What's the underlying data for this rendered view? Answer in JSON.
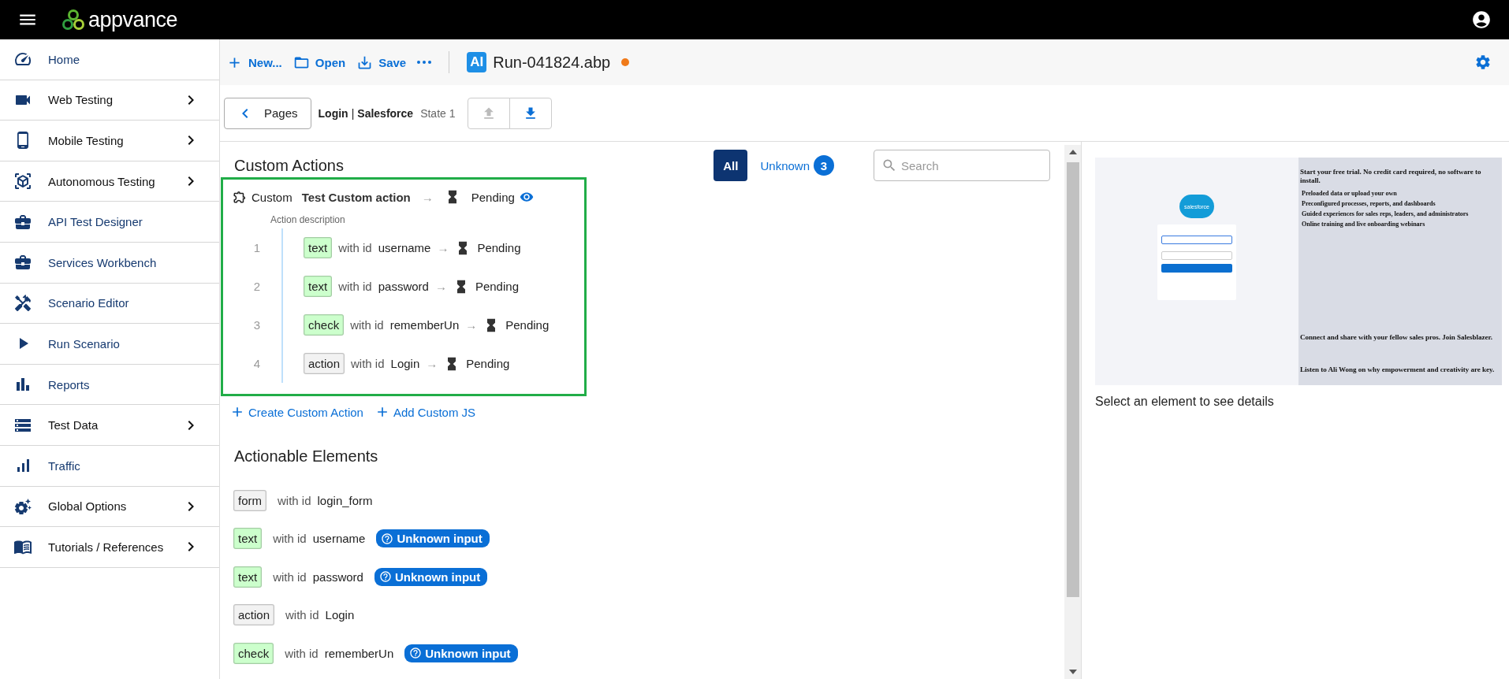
{
  "header": {
    "logo_text": "appvance"
  },
  "sidebar": {
    "items": [
      {
        "label": "Home",
        "expandable": false
      },
      {
        "label": "Web Testing",
        "expandable": true
      },
      {
        "label": "Mobile Testing",
        "expandable": true
      },
      {
        "label": "Autonomous Testing",
        "expandable": true
      },
      {
        "label": "API Test Designer",
        "expandable": false
      },
      {
        "label": "Services Workbench",
        "expandable": false
      },
      {
        "label": "Scenario Editor",
        "expandable": false
      },
      {
        "label": "Run Scenario",
        "expandable": false
      },
      {
        "label": "Reports",
        "expandable": false
      },
      {
        "label": "Test Data",
        "expandable": true
      },
      {
        "label": "Traffic",
        "expandable": false
      },
      {
        "label": "Global Options",
        "expandable": true
      },
      {
        "label": "Tutorials / References",
        "expandable": true
      }
    ]
  },
  "toolbar": {
    "actions": [
      {
        "label": "New..."
      },
      {
        "label": "Open"
      },
      {
        "label": "Save"
      }
    ],
    "file": {
      "badge": "AI",
      "name": "Run-041824.abp",
      "unsaved": true
    }
  },
  "breadcrumb": {
    "back_label": "Pages",
    "page": "Login",
    "separator": "|",
    "site": "Salesforce",
    "state": "State 1",
    "nav_buttons": [
      {
        "disabled": true
      },
      {
        "disabled": false
      }
    ]
  },
  "custom_actions": {
    "title": "Custom Actions",
    "filters": [
      {
        "label": "All",
        "selected": true
      },
      {
        "label": "Unknown",
        "count": "3",
        "selected": false
      }
    ],
    "search": {
      "placeholder": "Search"
    },
    "action": {
      "type": "Custom",
      "name": "Test Custom action",
      "arrow": "→",
      "status": "Pending",
      "description": "Action description",
      "steps": [
        {
          "number": "1",
          "tag": "text",
          "color": "#ccffcc",
          "with": "with id",
          "id": "username",
          "arrow": "→",
          "status": "Pending"
        },
        {
          "number": "2",
          "tag": "text",
          "color": "#ccffcc",
          "with": "with id",
          "id": "password",
          "arrow": "→",
          "status": "Pending"
        },
        {
          "number": "3",
          "tag": "check",
          "color": "#ccffcc",
          "with": "with id",
          "id": "rememberUn",
          "arrow": "→",
          "status": "Pending"
        },
        {
          "number": "4",
          "tag": "action",
          "color": "#f2f2f2",
          "with": "with id",
          "id": "Login",
          "arrow": "→",
          "status": "Pending"
        }
      ]
    },
    "links": [
      {
        "label": "Create Custom Action"
      },
      {
        "label": "Add Custom JS"
      }
    ]
  },
  "actionable_elements": {
    "title": "Actionable Elements",
    "rows": [
      {
        "tag": "form",
        "color": "#f2f2f2",
        "with": "with id",
        "id": "login_form"
      },
      {
        "tag": "text",
        "color": "#ccffcc",
        "with": "with id",
        "id": "username",
        "badge": "Unknown input"
      },
      {
        "tag": "text",
        "color": "#ccffcc",
        "with": "with id",
        "id": "password",
        "badge": "Unknown input"
      },
      {
        "tag": "action",
        "color": "#f2f2f2",
        "with": "with id",
        "id": "Login"
      },
      {
        "tag": "check",
        "color": "#ccffcc",
        "with": "with id",
        "id": "rememberUn",
        "badge": "Unknown input"
      }
    ]
  },
  "preview": {
    "logo_text": "salesforce",
    "heading": "Start your free trial. No credit card required, no software to install.",
    "bullets": [
      "Preloaded data or upload your own",
      "Preconfigured processes, reports, and dashboards",
      "Guided experiences for sales reps, leaders, and administrators",
      "Online training and live onboarding webinars"
    ],
    "heading_2": "Connect and share with your fellow sales pros. Join Salesblazer.",
    "heading_3": "Listen to Ali Wong on why empowerment and creativity are key."
  },
  "details": {
    "hint": "Select an element to see details"
  }
}
